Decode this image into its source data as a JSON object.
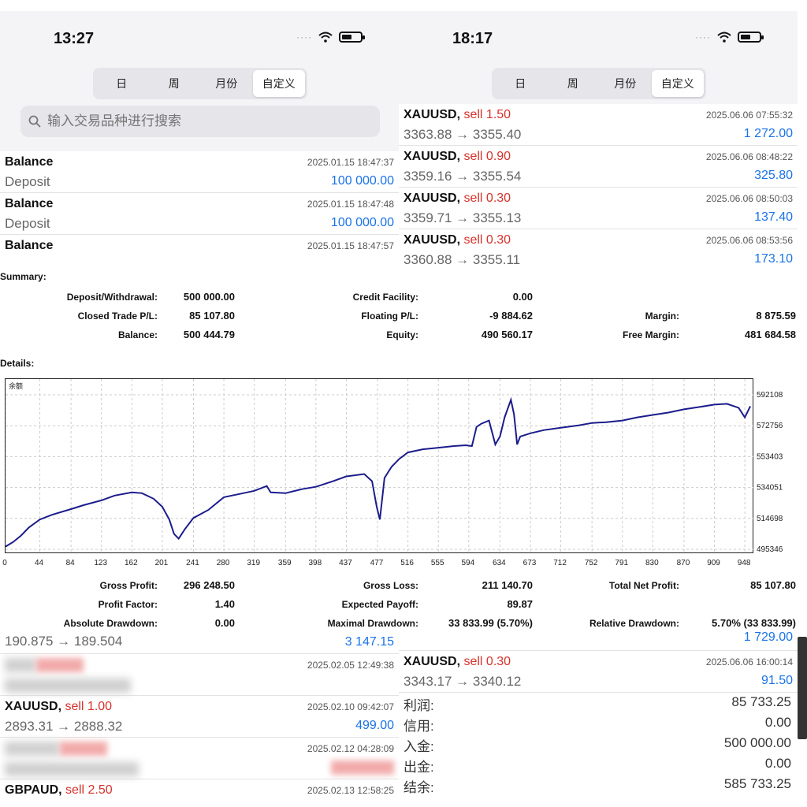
{
  "left_phone": {
    "time": "13:27",
    "tabs": [
      "日",
      "周",
      "月份",
      "自定义"
    ],
    "search_placeholder": "输入交易品种进行搜索",
    "rows": [
      {
        "title": "Balance",
        "sub": "Deposit",
        "time": "2025.01.15 18:47:37",
        "value": "100 000.00"
      },
      {
        "title": "Balance",
        "sub": "Deposit",
        "time": "2025.01.15 18:47:48",
        "value": "100 000.00"
      },
      {
        "title": "Balance",
        "sub": "",
        "time": "2025.01.15 18:47:57",
        "value": ""
      }
    ]
  },
  "right_phone": {
    "time": "18:17",
    "tabs": [
      "日",
      "周",
      "月份",
      "自定义"
    ],
    "rows": [
      {
        "symbol": "XAUUSD,",
        "side": "sell 1.50",
        "prices": "3363.88 → 3355.40",
        "time": "2025.06.06 07:55:32",
        "value": "1 272.00"
      },
      {
        "symbol": "XAUUSD,",
        "side": "sell 0.90",
        "prices": "3359.16 → 3355.54",
        "time": "2025.06.06 08:48:22",
        "value": "325.80"
      },
      {
        "symbol": "XAUUSD,",
        "side": "sell 0.30",
        "prices": "3359.71 → 3355.13",
        "time": "2025.06.06 08:50:03",
        "value": "137.40"
      },
      {
        "symbol": "XAUUSD,",
        "side": "sell 0.30",
        "prices": "3360.88 → 3355.11",
        "time": "2025.06.06 08:53:56",
        "value": "173.10"
      }
    ]
  },
  "report": {
    "summary_heading": "Summary:",
    "deposit_withdrawal_label": "Deposit/Withdrawal:",
    "deposit_withdrawal": "500 000.00",
    "closed_trade_pl_label": "Closed Trade P/L:",
    "closed_trade_pl": "85 107.80",
    "balance_label": "Balance:",
    "balance": "500 444.79",
    "credit_facility_label": "Credit Facility:",
    "credit_facility": "0.00",
    "floating_pl_label": "Floating P/L:",
    "floating_pl": "-9 884.62",
    "equity_label": "Equity:",
    "equity": "490 560.17",
    "margin_label": "Margin:",
    "margin": "8 875.59",
    "free_margin_label": "Free Margin:",
    "free_margin": "481 684.58",
    "details_heading": "Details:",
    "gross_profit_label": "Gross Profit:",
    "gross_profit": "296 248.50",
    "profit_factor_label": "Profit Factor:",
    "profit_factor": "1.40",
    "absolute_drawdown_label": "Absolute Drawdown:",
    "absolute_drawdown": "0.00",
    "gross_loss_label": "Gross Loss:",
    "gross_loss": "211 140.70",
    "expected_payoff_label": "Expected Payoff:",
    "expected_payoff": "89.87",
    "maximal_drawdown_label": "Maximal Drawdown:",
    "maximal_drawdown": "33 833.99 (5.70%)",
    "total_net_profit_label": "Total Net Profit:",
    "total_net_profit": "85 107.80",
    "relative_drawdown_label": "Relative Drawdown:",
    "relative_drawdown": "5.70% (33 833.99)"
  },
  "chart_data": {
    "type": "line",
    "legend": "余额",
    "x_ticks": [
      0,
      44,
      84,
      123,
      162,
      201,
      241,
      280,
      319,
      359,
      398,
      437,
      477,
      516,
      555,
      594,
      634,
      673,
      712,
      752,
      791,
      830,
      870,
      909,
      948
    ],
    "y_ticks": [
      495346,
      514698,
      534051,
      553403,
      572756,
      592108
    ],
    "ylim": [
      495346,
      592108
    ],
    "xlim": [
      0,
      960
    ],
    "grid": true,
    "series": [
      {
        "x": [
          0,
          10,
          20,
          30,
          44,
          60,
          84,
          100,
          123,
          140,
          162,
          175,
          190,
          201,
          210,
          216,
          222,
          230,
          241,
          260,
          280,
          300,
          319,
          335,
          340,
          359,
          380,
          398,
          420,
          437,
          460,
          470,
          476,
          480,
          486,
          495,
          505,
          516,
          535,
          555,
          575,
          590,
          598,
          604,
          610,
          620,
          628,
          634,
          640,
          648,
          652,
          656,
          660,
          673,
          690,
          712,
          735,
          752,
          770,
          791,
          810,
          830,
          850,
          870,
          890,
          909,
          925,
          940,
          948,
          955
        ],
        "y": [
          497000,
          500000,
          504000,
          509000,
          514000,
          517000,
          520500,
          523000,
          526000,
          529000,
          531000,
          530500,
          527000,
          522000,
          514000,
          505000,
          502000,
          508000,
          515000,
          520000,
          528000,
          530000,
          532000,
          535000,
          531000,
          530500,
          533000,
          534500,
          538000,
          541000,
          542500,
          538000,
          522000,
          514000,
          540000,
          547000,
          552000,
          556000,
          558000,
          559000,
          560000,
          560500,
          560000,
          572000,
          574000,
          576000,
          561000,
          566000,
          578000,
          589000,
          580000,
          561000,
          566000,
          568000,
          570000,
          571500,
          573000,
          574500,
          575000,
          576000,
          578000,
          579500,
          581000,
          583000,
          584500,
          586000,
          586500,
          584000,
          578000,
          585000
        ]
      }
    ]
  },
  "bottom_left": {
    "top_row": {
      "prices": "190.875 → 189.504",
      "value": "3 147.15"
    },
    "rows": [
      {
        "symbol": "",
        "side": "",
        "prices": "",
        "time": "2025.02.05 12:49:38",
        "value": "",
        "blurred": true
      },
      {
        "symbol": "XAUUSD,",
        "side": "sell 1.00",
        "prices": "2893.31 → 2888.32",
        "time": "2025.02.10 09:42:07",
        "value": "499.00",
        "blurred": false
      },
      {
        "symbol": "",
        "side": "",
        "prices": "",
        "time": "2025.02.12 04:28:09",
        "value": "",
        "blurred": true
      },
      {
        "symbol": "GBPAUD,",
        "side": "sell 2.50",
        "prices": "",
        "time": "2025.02.13 12:58:25",
        "value": "",
        "blurred": false
      }
    ]
  },
  "bottom_right": {
    "top_value": "1 729.00",
    "row": {
      "symbol": "XAUUSD,",
      "side": "sell 0.30",
      "prices": "3343.17 → 3340.12",
      "time": "2025.06.06 16:00:14",
      "value": "91.50"
    },
    "summary": [
      {
        "label": "利润:",
        "value": "85 733.25"
      },
      {
        "label": "信用:",
        "value": "0.00"
      },
      {
        "label": "入金:",
        "value": "500 000.00"
      },
      {
        "label": "出金:",
        "value": "0.00"
      },
      {
        "label": "结余:",
        "value": "585 733.25"
      }
    ]
  },
  "colors": {
    "sell": "#d6322b",
    "value_blue": "#1a73e8",
    "line": "#1c1c8c"
  }
}
